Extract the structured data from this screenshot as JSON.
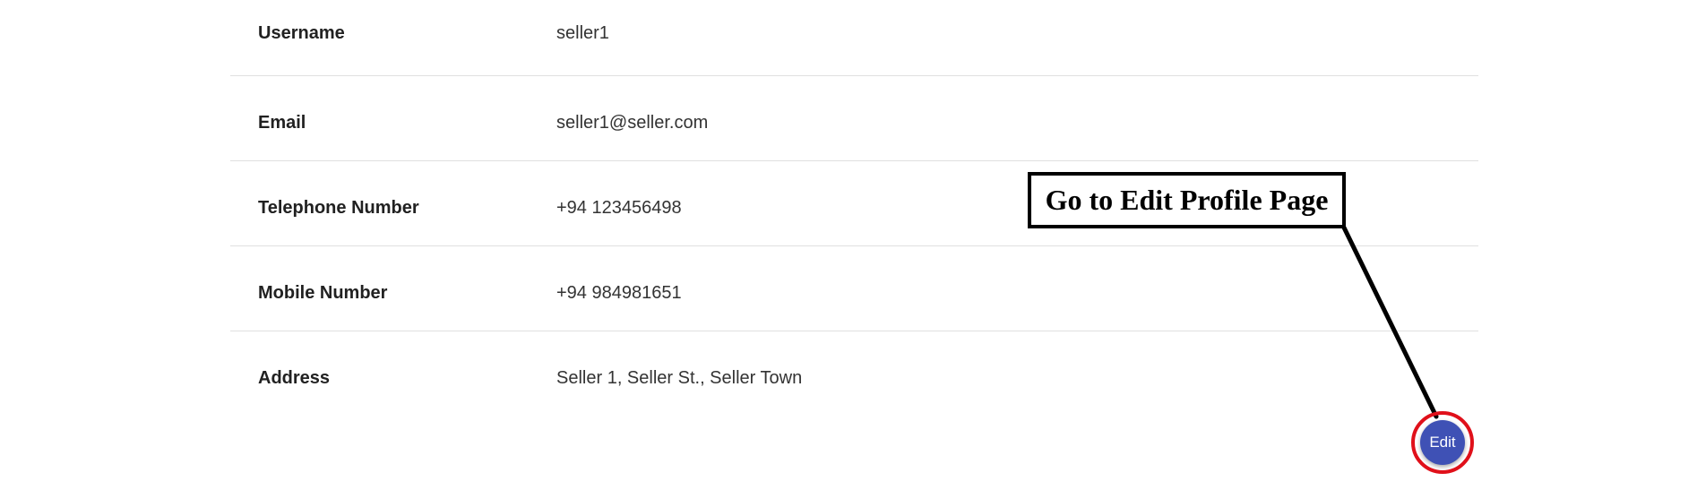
{
  "profile": {
    "rows": [
      {
        "label": "Username",
        "value": "seller1"
      },
      {
        "label": "Email",
        "value": "seller1@seller.com"
      },
      {
        "label": "Telephone Number",
        "value": "+94 123456498"
      },
      {
        "label": "Mobile Number",
        "value": "+94 984981651"
      },
      {
        "label": "Address",
        "value": "Seller 1, Seller St., Seller Town"
      }
    ]
  },
  "edit_button": {
    "label": "Edit",
    "color": "#3f51b5",
    "highlight_color": "#e0101a"
  },
  "annotation": {
    "text": "Go to Edit Profile Page"
  }
}
